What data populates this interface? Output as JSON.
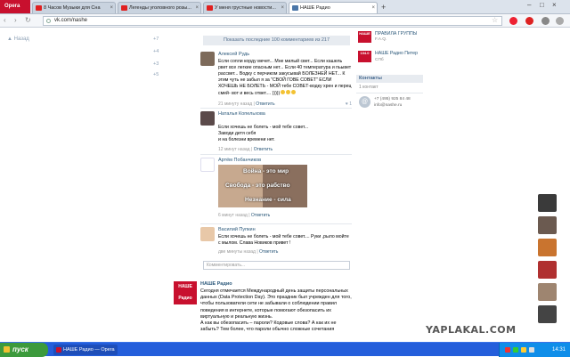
{
  "browser": {
    "app_name": "Opera",
    "tabs": [
      {
        "label": "8 Часов Музыки для Сна"
      },
      {
        "label": "Легенды уголовного розы..."
      },
      {
        "label": "У меня грустные новости..."
      },
      {
        "label": "НАШЕ Радио"
      }
    ],
    "new_tab": "+",
    "url": "vk.com/nashe"
  },
  "left": {
    "back_label": "Назад",
    "mini": [
      "+7",
      "+4",
      "+3",
      "+5"
    ]
  },
  "feed": {
    "show_more": "Показать последние 100 комментариев из 217",
    "comments": [
      {
        "name": "Алексей Рудь",
        "text": "Если сопли корду мечет... Мне милый свет... Если кашель рвет все легкие опасным нет... Если 40 температура и пьывет рассвет... Водку с перчиком закусывай БОЛЕЗНЕЙ НЕТ... К этим чуть не забыл я за \"СВОЙ ГОВЕ СОВЕТ\" ЕСЛИ ХОЧЕШЬ НЕ БОЛЕТЬ - МОЙ тебе СОВЕТ-водку хрен и перец смей- вот и весь ответ.... )))))",
        "time": "21 минуту назад",
        "reply": "Ответить",
        "likes": "1"
      },
      {
        "name": "Наталья Копельхова",
        "text": "Если хочешь не болеть - мой тебе совет...\nЗаводи детя себя\nи на болезни времени нет.",
        "time": "12 минут назад",
        "reply": "Ответить"
      },
      {
        "name": "Артём Побанчиков",
        "image_text": [
          "Война - это мир",
          "Свобода - это рабство",
          "Незнание - сила"
        ],
        "time": "6 минут назад",
        "reply": "Ответить"
      },
      {
        "name": "Василий Пупкин",
        "text": "Если хочешь не болеть - мой тебе совет.... Руки ,рыло мойте с мылом. Слава Новиков привет !",
        "time": "две минуты назад",
        "reply": "Ответить"
      }
    ],
    "comment_placeholder": "Комментировать..."
  },
  "post": {
    "logo": "НАШЕ Радио",
    "name": "НАШЕ Радио",
    "text": "Сегодня отмечается Международный день защиты персональных данных (Data Protection Day). Это праздник был учрежден для того, чтобы пользователи сети не забывали о соблюдении правил поведения в интернете, которые помогают обезопасить их виртуальную и реальную жизнь.\nА как вы обезопасить – пароли? Кодовые слова? А как их не забыть? Тем более, что пароли обычно сложные сочетания"
  },
  "right": {
    "groups": [
      {
        "name": "ПРАВИЛА ГРУППЫ",
        "sub": "F.A.Q.",
        "logo": "НАШЕ"
      },
      {
        "name": "НАШЕ Радио Питер",
        "sub": "СПб",
        "logo": "104.0"
      }
    ],
    "contacts_header": "Контакты",
    "contacts_count": "1 контакт",
    "contact_lines": [
      "+7 (495) 925 84 48",
      "info@nashe.ru"
    ]
  },
  "watermark": "YAPLAKAL.COM",
  "taskbar": {
    "start": "пуск",
    "items": [
      "НАШЕ Радио — Opera"
    ],
    "clock": "14:31"
  },
  "colors": {
    "vk_blue": "#2b587a",
    "nashe_red": "#c8102e",
    "taskbar_blue": "#245edb"
  }
}
